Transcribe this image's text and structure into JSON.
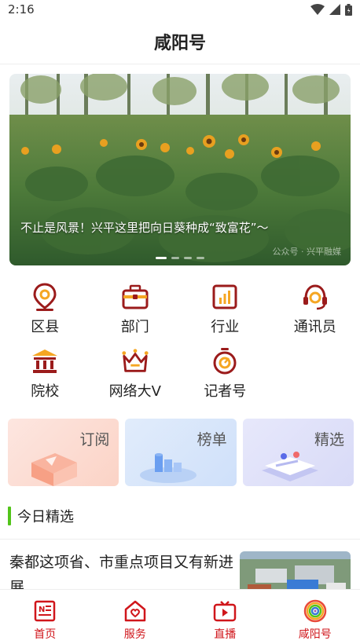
{
  "status_bar": {
    "time": "2:16"
  },
  "header": {
    "title": "咸阳号"
  },
  "banner": {
    "caption": "不止是风景！兴平这里把向日葵种成“致富花”～",
    "watermark": "公众号 · 兴平融媒",
    "slide_count": 4,
    "active_slide": 1
  },
  "categories": [
    {
      "label": "区县",
      "icon": "location-pin-icon"
    },
    {
      "label": "部门",
      "icon": "briefcase-icon"
    },
    {
      "label": "行业",
      "icon": "bar-chart-icon"
    },
    {
      "label": "通讯员",
      "icon": "headset-icon"
    },
    {
      "label": "院校",
      "icon": "institution-icon"
    },
    {
      "label": "网络大V",
      "icon": "crown-icon"
    },
    {
      "label": "记者号",
      "icon": "stopwatch-icon"
    }
  ],
  "tiles": [
    {
      "label": "订阅"
    },
    {
      "label": "榜单"
    },
    {
      "label": "精选"
    }
  ],
  "section": {
    "title": "今日精选"
  },
  "news": [
    {
      "title": "秦都这项省、市重点项目又有新进展"
    }
  ],
  "tabbar": [
    {
      "label": "首页",
      "icon": "newspaper-icon"
    },
    {
      "label": "服务",
      "icon": "heart-house-icon"
    },
    {
      "label": "直播",
      "icon": "tv-icon"
    },
    {
      "label": "咸阳号",
      "icon": "rainbow-logo-icon"
    }
  ],
  "colors": {
    "brand_red": "#d0161b",
    "icon_yellow": "#f5a623",
    "section_green": "#52c41a"
  }
}
